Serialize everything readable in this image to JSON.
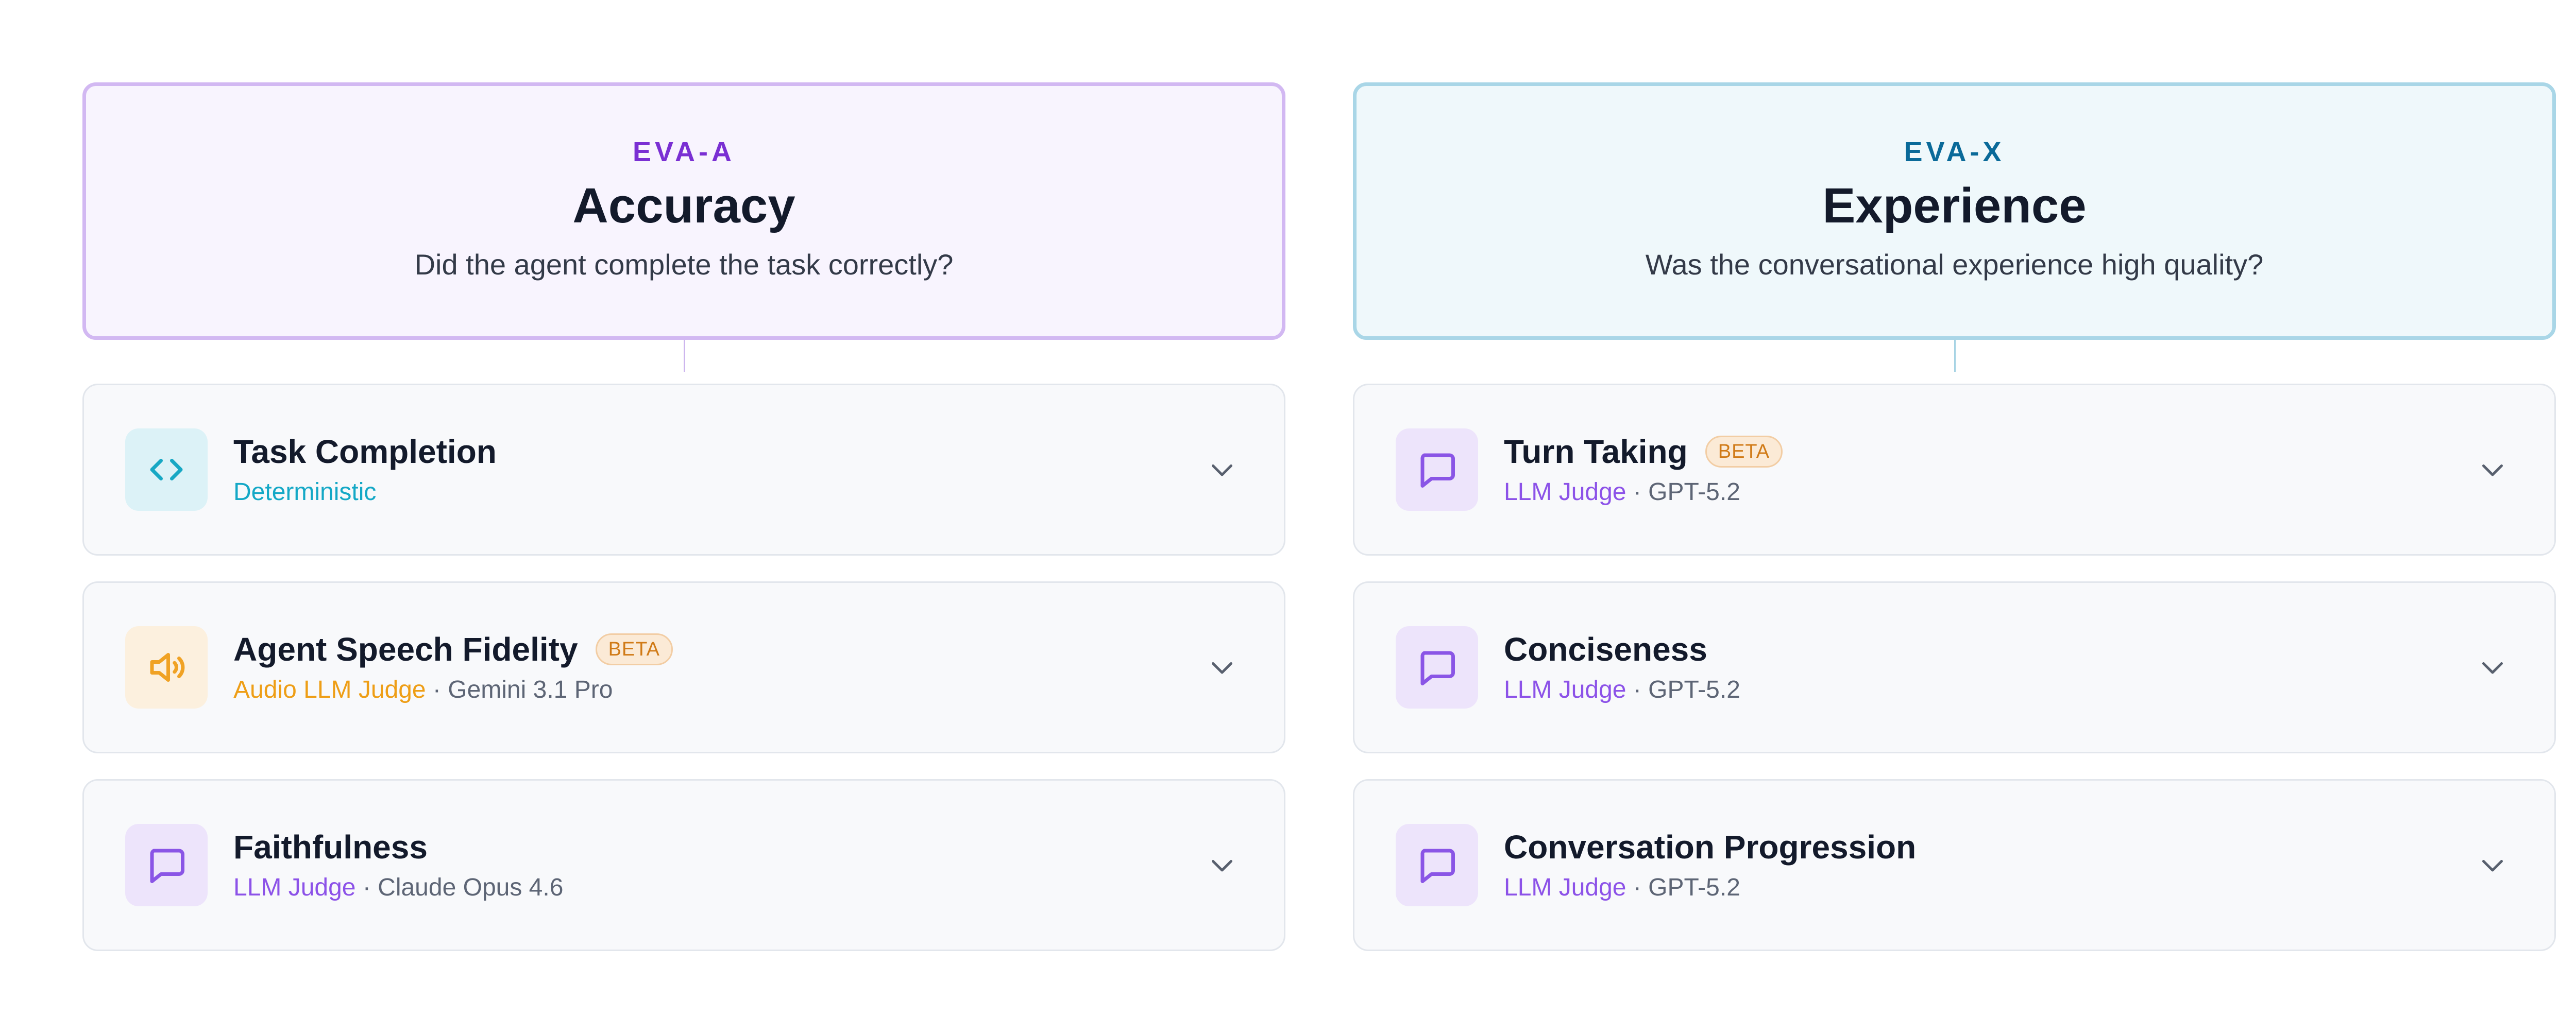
{
  "columns": [
    {
      "eyebrow": "EVA-A",
      "title": "Accuracy",
      "question": "Did the agent complete the task correctly?",
      "metrics": [
        {
          "title": "Task Completion",
          "badge": "",
          "method": "Deterministic",
          "separator": "",
          "model": "",
          "icon": "code-icon"
        },
        {
          "title": "Agent Speech Fidelity",
          "badge": "BETA",
          "method": "Audio LLM Judge",
          "separator": " · ",
          "model": "Gemini 3.1 Pro",
          "icon": "speaker-icon"
        },
        {
          "title": "Faithfulness",
          "badge": "",
          "method": "LLM Judge",
          "separator": " · ",
          "model": "Claude Opus 4.6",
          "icon": "chat-bubble-icon"
        }
      ]
    },
    {
      "eyebrow": "EVA-X",
      "title": "Experience",
      "question": "Was the conversational experience high quality?",
      "metrics": [
        {
          "title": "Turn Taking",
          "badge": "BETA",
          "method": "LLM Judge",
          "separator": " · ",
          "model": "GPT-5.2",
          "icon": "chat-bubble-icon"
        },
        {
          "title": "Conciseness",
          "badge": "",
          "method": "LLM Judge",
          "separator": " · ",
          "model": "GPT-5.2",
          "icon": "chat-bubble-icon"
        },
        {
          "title": "Conversation Progression",
          "badge": "",
          "method": "LLM Judge",
          "separator": " · ",
          "model": "GPT-5.2",
          "icon": "chat-bubble-icon"
        }
      ]
    }
  ],
  "colors": {
    "accuracy_accent": "#7a2fd3",
    "experience_accent": "#0a6a99",
    "deterministic": "#14a8c6",
    "audio_llm_judge": "#ee9e16",
    "llm_judge": "#8c52e8",
    "beta_badge": "#d07a16"
  }
}
